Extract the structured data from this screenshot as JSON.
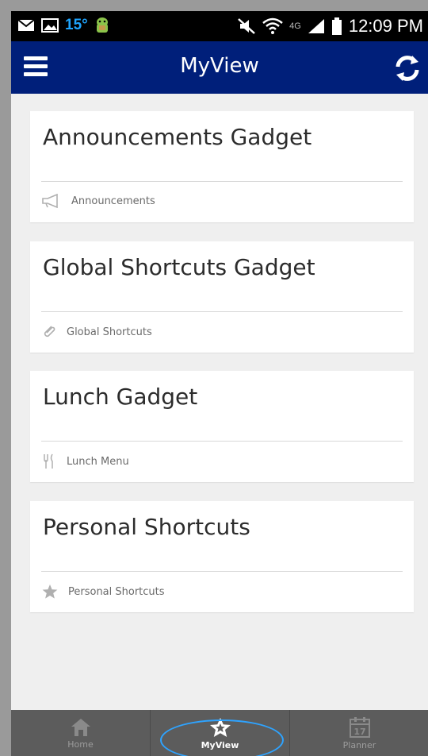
{
  "status_bar": {
    "temperature": "15°",
    "network_label": "4G",
    "time": "12:09 PM"
  },
  "app_bar": {
    "title": "MyView",
    "menu_icon": "hamburger-menu-icon",
    "refresh_icon": "refresh-icon"
  },
  "cards": [
    {
      "title": "Announcements Gadget",
      "footer": "Announcements",
      "icon": "megaphone-icon"
    },
    {
      "title": "Global Shortcuts Gadget",
      "footer": "Global Shortcuts",
      "icon": "paperclip-icon"
    },
    {
      "title": "Lunch Gadget",
      "footer": "Lunch Menu",
      "icon": "utensils-icon"
    },
    {
      "title": "Personal Shortcuts",
      "footer": "Personal Shortcuts",
      "icon": "star-icon"
    }
  ],
  "tabs": [
    {
      "label": "Home",
      "icon": "home-icon",
      "active": false
    },
    {
      "label": "MyView",
      "icon": "star-badge-icon",
      "active": true
    },
    {
      "label": "Planner",
      "icon": "calendar-icon",
      "active": false,
      "calendar_day": "17"
    }
  ],
  "colors": {
    "app_bar": "#001f7a",
    "status_temp": "#1ea5ff",
    "background": "#efefef",
    "tab_bar": "#5c5c5c",
    "highlight": "#2ea3ff"
  }
}
